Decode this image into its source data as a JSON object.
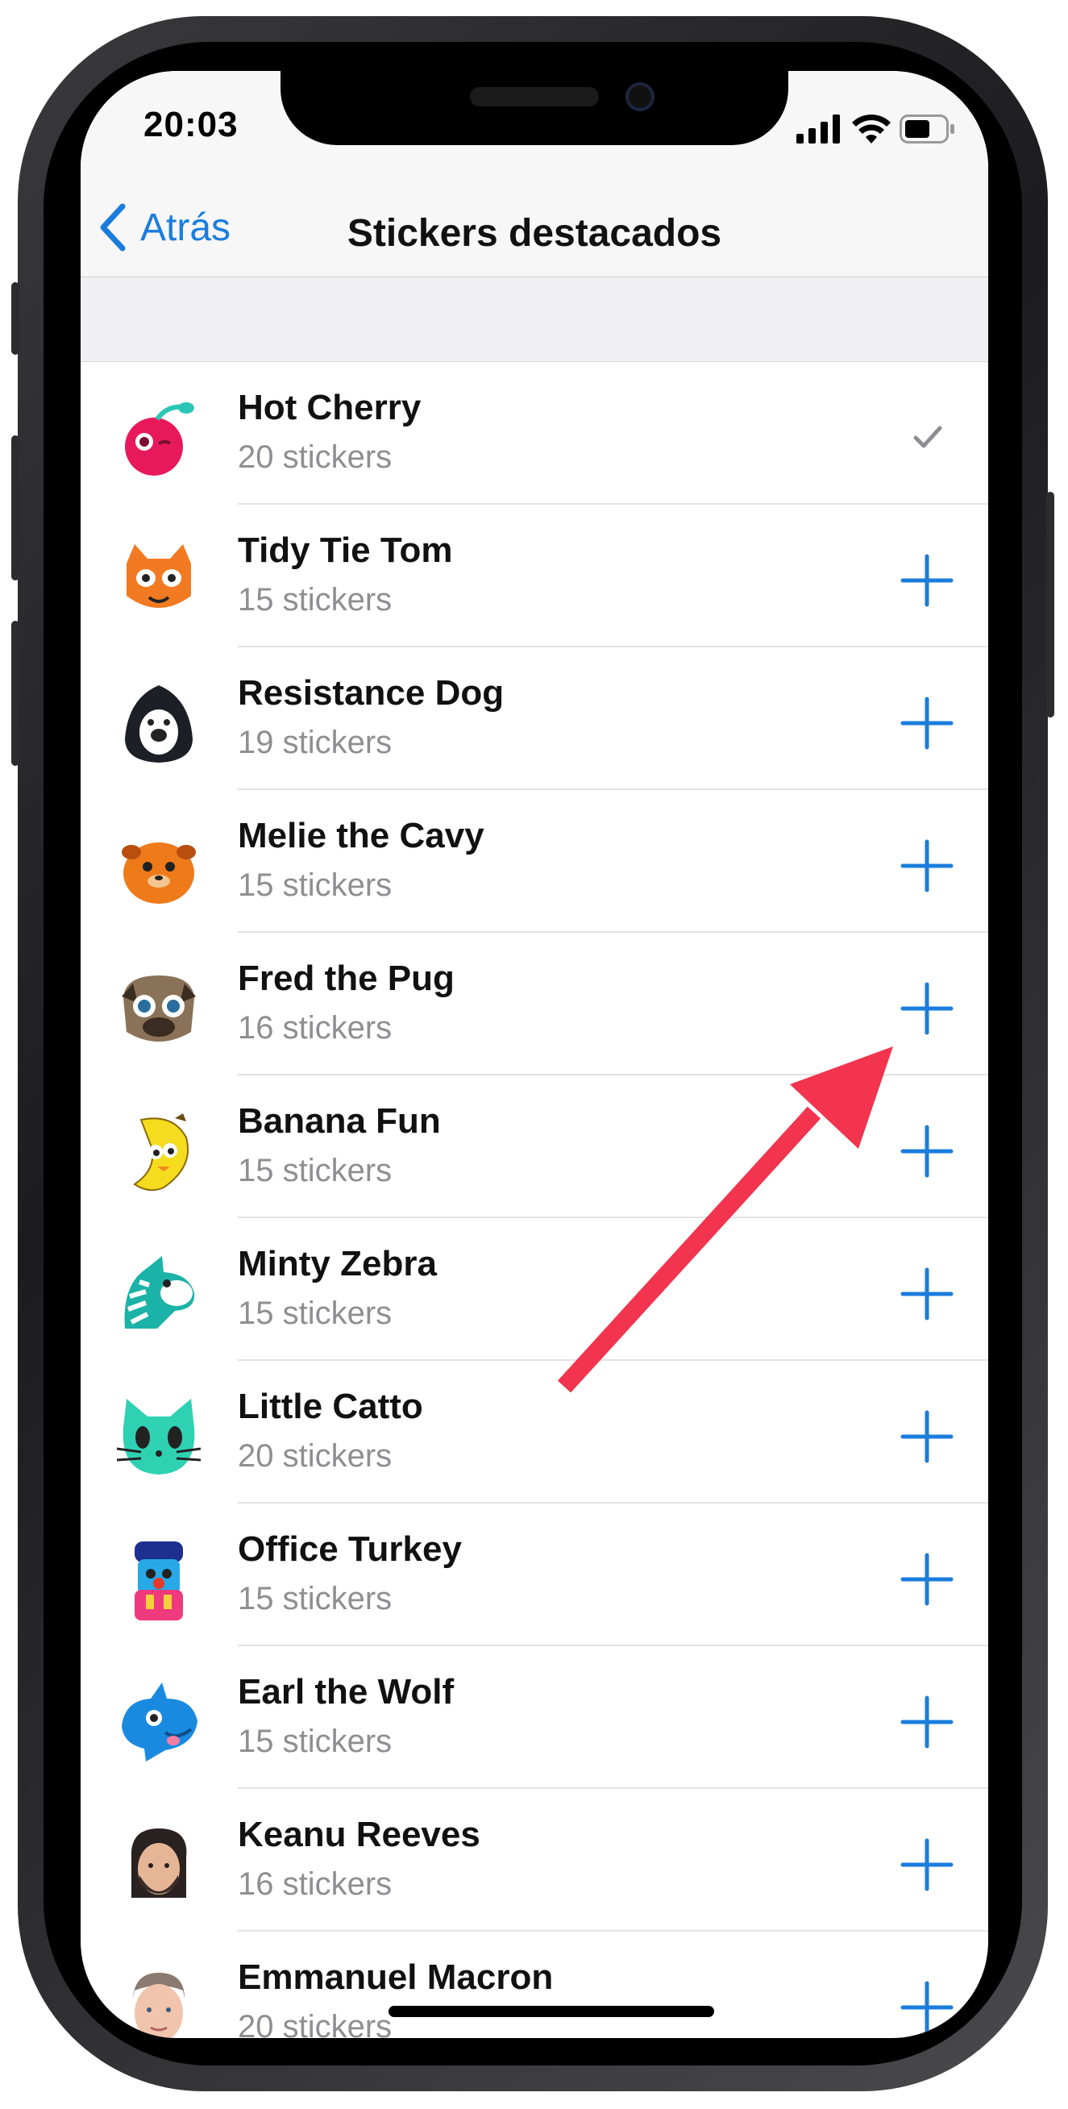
{
  "status_bar": {
    "time": "20:03"
  },
  "nav": {
    "back_label": "Atrás",
    "title": "Stickers destacados"
  },
  "colors": {
    "accent": "#1a7ddd",
    "arrow": "#f2344e",
    "check": "#8e8e93"
  },
  "sticker_packs": [
    {
      "name": "Hot Cherry",
      "count": "20 stickers",
      "state": "added",
      "icon": "hot-cherry-icon"
    },
    {
      "name": "Tidy Tie Tom",
      "count": "15 stickers",
      "state": "add",
      "icon": "cat-icon"
    },
    {
      "name": "Resistance Dog",
      "count": "19 stickers",
      "state": "add",
      "icon": "hooded-dog-icon"
    },
    {
      "name": "Melie the Cavy",
      "count": "15 stickers",
      "state": "add",
      "icon": "guinea-pig-icon"
    },
    {
      "name": "Fred the Pug",
      "count": "16 stickers",
      "state": "add",
      "icon": "pug-icon"
    },
    {
      "name": "Banana Fun",
      "count": "15 stickers",
      "state": "add",
      "icon": "banana-icon"
    },
    {
      "name": "Minty Zebra",
      "count": "15 stickers",
      "state": "add",
      "icon": "zebra-icon"
    },
    {
      "name": "Little Catto",
      "count": "20 stickers",
      "state": "add",
      "icon": "green-cat-icon"
    },
    {
      "name": "Office Turkey",
      "count": "15 stickers",
      "state": "add",
      "icon": "turkey-icon"
    },
    {
      "name": "Earl the Wolf",
      "count": "15 stickers",
      "state": "add",
      "icon": "blue-wolf-icon"
    },
    {
      "name": "Keanu Reeves",
      "count": "16 stickers",
      "state": "add",
      "icon": "keanu-face-icon"
    },
    {
      "name": "Emmanuel Macron",
      "count": "20 stickers",
      "state": "add",
      "icon": "macron-face-icon"
    }
  ]
}
